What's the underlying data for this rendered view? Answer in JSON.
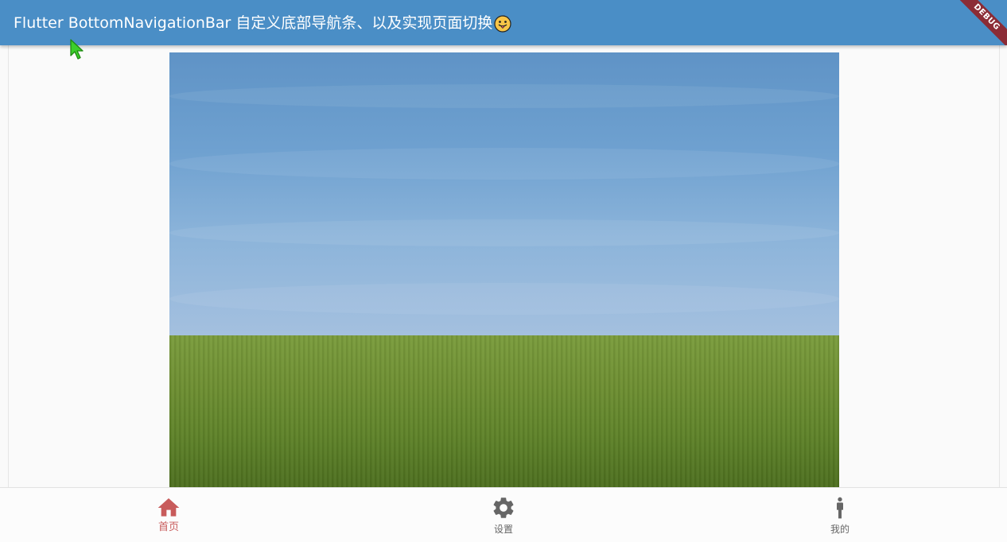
{
  "appbar": {
    "title": "Flutter BottomNavigationBar 自定义底部导航条、以及实现页面切换",
    "emoji_icon": "tongue-out-face-emoji",
    "background_color": "#4a8ec6",
    "debug_banner": "DEBUG",
    "debug_banner_color": "#8b2c36"
  },
  "content": {
    "image_icon": "landscape-image"
  },
  "bottom_nav": {
    "active_color": "#c85b5b",
    "inactive_color": "#666666",
    "items": [
      {
        "label": "首页",
        "icon": "home-icon",
        "active": true
      },
      {
        "label": "设置",
        "icon": "gear-icon",
        "active": false
      },
      {
        "label": "我的",
        "icon": "person-icon",
        "active": false
      }
    ]
  }
}
